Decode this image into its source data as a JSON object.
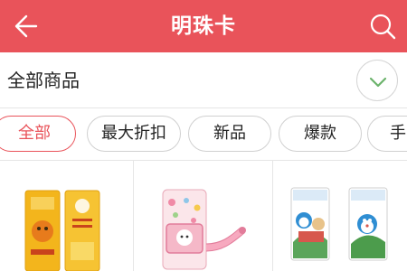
{
  "header": {
    "title": "明珠卡",
    "back_icon": "back-arrow-icon",
    "search_icon": "search-icon",
    "background": "#e9535a"
  },
  "category": {
    "label": "全部商品",
    "expand_icon": "chevron-down-icon",
    "accent": "#6bb36b"
  },
  "filters": [
    {
      "label": "全部",
      "active": true
    },
    {
      "label": "最大折扣",
      "active": false
    },
    {
      "label": "新品",
      "active": false
    },
    {
      "label": "爆款",
      "active": false
    },
    {
      "label": "手",
      "active": false
    }
  ],
  "products": [
    {
      "image": "yellow-cartoon-cards"
    },
    {
      "image": "hello-kitty-card-holder"
    },
    {
      "image": "doraemon-cards"
    }
  ]
}
